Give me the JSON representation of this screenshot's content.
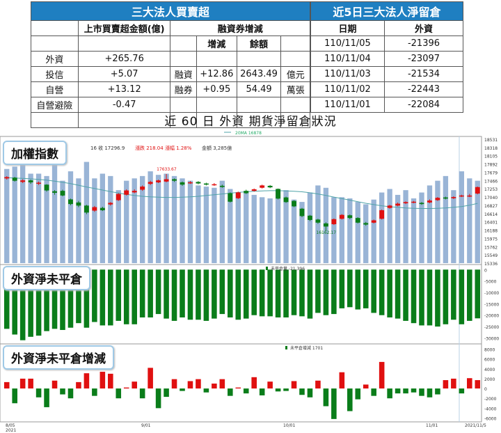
{
  "table_left": {
    "title": "三大法人買賣超",
    "col_amount": "上市買賣超金額(億)",
    "col_margin": "融資券增減",
    "col_change": "增減",
    "col_balance": "餘額",
    "rows": [
      {
        "name": "外資",
        "amount": "+265.76",
        "m_label": "",
        "m_change": "",
        "m_balance": "",
        "m_unit": ""
      },
      {
        "name": "投信",
        "amount": "+5.07",
        "m_label": "融資",
        "m_change": "+12.86",
        "m_balance": "2643.49",
        "m_unit": "億元"
      },
      {
        "name": "自營",
        "amount": "+13.12",
        "m_label": "融券",
        "m_change": "+0.95",
        "m_balance": "54.49",
        "m_unit": "萬張"
      },
      {
        "name": "自營避險",
        "amount": "-0.47",
        "m_label": "",
        "m_change": "",
        "m_balance": "",
        "m_unit": ""
      },
      {
        "name": "",
        "amount": "",
        "m_label": "",
        "m_change": "",
        "m_balance": "",
        "m_unit": ""
      }
    ]
  },
  "table_right": {
    "title": "近5日三大法人淨留倉",
    "col_date": "日期",
    "col_foreign": "外資",
    "rows": [
      {
        "date": "110/11/05",
        "value": "-21396"
      },
      {
        "date": "110/11/04",
        "value": "-23097"
      },
      {
        "date": "110/11/03",
        "value": "-21534"
      },
      {
        "date": "110/11/02",
        "value": "-22443"
      },
      {
        "date": "110/11/01",
        "value": "-22084"
      }
    ]
  },
  "heading": "近 60 日 外資 期貨淨留倉狀況",
  "chart_data": {
    "type": "bar",
    "x_labels": [
      "8/05\n2021",
      "9/01",
      "10/01",
      "11/01",
      "2021/11/5"
    ],
    "panels": [
      {
        "title": "加權指數",
        "info": "16 收 17296.9",
        "info_change": "漲跌 218.04 漲幅 1.28%",
        "info_amount": "金額 3,285億",
        "ma_legend": "20MA 16878",
        "high_label": "17633.67",
        "low_label": "16162.17",
        "yticks": [
          "18531",
          "18318",
          "18105",
          "17892",
          "17679",
          "17466",
          "17253",
          "17040",
          "16827",
          "16614",
          "16401",
          "16188",
          "15975",
          "15762",
          "15549",
          "15336"
        ],
        "ylim": [
          15336,
          18531
        ],
        "volume": [
          80,
          82,
          84,
          76,
          76,
          74,
          84,
          70,
          78,
          72,
          86,
          72,
          76,
          74,
          62,
          70,
          72,
          74,
          78,
          75,
          76,
          74,
          72,
          70,
          66,
          65,
          64,
          70,
          63,
          60,
          60,
          58,
          56,
          55,
          62,
          62,
          54,
          52,
          60,
          66,
          64,
          56,
          56,
          55,
          52,
          50,
          54,
          60,
          63,
          58,
          62,
          55,
          60,
          66,
          70,
          74,
          62,
          78,
          72,
          70
        ],
        "candles": [
          {
            "o": 17520,
            "c": 17555,
            "h": 17580,
            "l": 17490
          },
          {
            "o": 17540,
            "c": 17460,
            "h": 17560,
            "l": 17440
          },
          {
            "o": 17430,
            "c": 17470,
            "h": 17500,
            "l": 17400
          },
          {
            "o": 17470,
            "c": 17420,
            "h": 17490,
            "l": 17380
          },
          {
            "o": 17400,
            "c": 17410,
            "h": 17440,
            "l": 17350
          },
          {
            "o": 17360,
            "c": 17210,
            "h": 17370,
            "l": 17180
          },
          {
            "o": 17190,
            "c": 17150,
            "h": 17220,
            "l": 17100
          },
          {
            "o": 17200,
            "c": 17080,
            "h": 17230,
            "l": 17060
          },
          {
            "o": 16980,
            "c": 16860,
            "h": 17000,
            "l": 16830
          },
          {
            "o": 16900,
            "c": 16820,
            "h": 16940,
            "l": 16780
          },
          {
            "o": 16820,
            "c": 16640,
            "h": 16840,
            "l": 16600
          },
          {
            "o": 16690,
            "c": 16780,
            "h": 16810,
            "l": 16660
          },
          {
            "o": 16760,
            "c": 16700,
            "h": 16790,
            "l": 16680
          },
          {
            "o": 16850,
            "c": 16890,
            "h": 16910,
            "l": 16820
          },
          {
            "o": 16960,
            "c": 17120,
            "h": 17140,
            "l": 16940
          },
          {
            "o": 17100,
            "c": 17210,
            "h": 17240,
            "l": 17080
          },
          {
            "o": 17160,
            "c": 17200,
            "h": 17240,
            "l": 17140
          },
          {
            "o": 17230,
            "c": 17310,
            "h": 17340,
            "l": 17200
          },
          {
            "o": 17380,
            "c": 17430,
            "h": 17460,
            "l": 17350
          },
          {
            "o": 17420,
            "c": 17470,
            "h": 17490,
            "l": 17400
          },
          {
            "o": 17440,
            "c": 17500,
            "h": 17634,
            "l": 17420
          },
          {
            "o": 17500,
            "c": 17460,
            "h": 17520,
            "l": 17430
          },
          {
            "o": 17420,
            "c": 17360,
            "h": 17440,
            "l": 17330
          },
          {
            "o": 17400,
            "c": 17420,
            "h": 17450,
            "l": 17380
          },
          {
            "o": 17430,
            "c": 17390,
            "h": 17450,
            "l": 17370
          },
          {
            "o": 17390,
            "c": 17360,
            "h": 17410,
            "l": 17340
          },
          {
            "o": 17350,
            "c": 17370,
            "h": 17400,
            "l": 17330
          },
          {
            "o": 17330,
            "c": 17300,
            "h": 17360,
            "l": 17280
          },
          {
            "o": 17140,
            "c": 16920,
            "h": 17160,
            "l": 16900
          },
          {
            "o": 17010,
            "c": 17160,
            "h": 17180,
            "l": 16990
          },
          {
            "o": 17200,
            "c": 17140,
            "h": 17230,
            "l": 17120
          },
          {
            "o": 17200,
            "c": 17240,
            "h": 17260,
            "l": 17180
          },
          {
            "o": 17280,
            "c": 17340,
            "h": 17360,
            "l": 17260
          },
          {
            "o": 17330,
            "c": 17290,
            "h": 17350,
            "l": 17270
          },
          {
            "o": 17250,
            "c": 17000,
            "h": 17260,
            "l": 16980
          },
          {
            "o": 17030,
            "c": 16910,
            "h": 17050,
            "l": 16890
          },
          {
            "o": 16940,
            "c": 16800,
            "h": 16960,
            "l": 16780
          },
          {
            "o": 16740,
            "c": 16550,
            "h": 16760,
            "l": 16520
          },
          {
            "o": 16560,
            "c": 16450,
            "h": 16580,
            "l": 16420
          },
          {
            "o": 16460,
            "c": 16380,
            "h": 16480,
            "l": 16350
          },
          {
            "o": 16360,
            "c": 16280,
            "h": 16390,
            "l": 16162
          },
          {
            "o": 16340,
            "c": 16470,
            "h": 16490,
            "l": 16320
          },
          {
            "o": 16480,
            "c": 16580,
            "h": 16600,
            "l": 16460
          },
          {
            "o": 16570,
            "c": 16500,
            "h": 16590,
            "l": 16470
          },
          {
            "o": 16500,
            "c": 16380,
            "h": 16520,
            "l": 16360
          },
          {
            "o": 16370,
            "c": 16330,
            "h": 16400,
            "l": 16300
          },
          {
            "o": 16380,
            "c": 16440,
            "h": 16460,
            "l": 16360
          },
          {
            "o": 16480,
            "c": 16700,
            "h": 16720,
            "l": 16460
          },
          {
            "o": 16760,
            "c": 16820,
            "h": 16840,
            "l": 16740
          },
          {
            "o": 16820,
            "c": 16870,
            "h": 16900,
            "l": 16800
          },
          {
            "o": 16880,
            "c": 16910,
            "h": 16930,
            "l": 16860
          },
          {
            "o": 16900,
            "c": 16920,
            "h": 16940,
            "l": 16880
          },
          {
            "o": 16890,
            "c": 16860,
            "h": 16910,
            "l": 16840
          },
          {
            "o": 16900,
            "c": 16950,
            "h": 16980,
            "l": 16880
          },
          {
            "o": 16960,
            "c": 17020,
            "h": 17040,
            "l": 16940
          },
          {
            "o": 17030,
            "c": 17000,
            "h": 17050,
            "l": 16980
          },
          {
            "o": 17010,
            "c": 17040,
            "h": 17060,
            "l": 16990
          },
          {
            "o": 17060,
            "c": 17080,
            "h": 17100,
            "l": 17040
          },
          {
            "o": 17060,
            "c": 17079,
            "h": 17120,
            "l": 17040
          },
          {
            "o": 17130,
            "c": 17297,
            "h": 17310,
            "l": 17110
          }
        ],
        "ma": [
          17540,
          17530,
          17520,
          17510,
          17495,
          17475,
          17450,
          17420,
          17385,
          17345,
          17300,
          17260,
          17220,
          17180,
          17145,
          17110,
          17080,
          17060,
          17045,
          17035,
          17030,
          17030,
          17035,
          17045,
          17060,
          17080,
          17100,
          17120,
          17140,
          17160,
          17175,
          17190,
          17200,
          17205,
          17205,
          17200,
          17190,
          17175,
          17150,
          17120,
          17080,
          17040,
          17000,
          16960,
          16920,
          16880,
          16845,
          16815,
          16790,
          16775,
          16760,
          16750,
          16745,
          16745,
          16750,
          16760,
          16775,
          16795,
          16830,
          16878
        ]
      },
      {
        "title": "外資淨未平倉",
        "legend": "未平倉量 -21,396",
        "yticks": [
          "0",
          "-5000",
          "-10000",
          "-15000",
          "-20000",
          "-25000",
          "-30000"
        ],
        "ylim": [
          -32000,
          1000
        ],
        "values": [
          -26000,
          -28500,
          -31000,
          -29500,
          -29000,
          -27000,
          -26000,
          -26500,
          -25500,
          -23500,
          -25500,
          -23000,
          -24500,
          -24500,
          -22500,
          -24000,
          -24000,
          -21000,
          -21000,
          -19500,
          -21500,
          -22500,
          -21000,
          -22000,
          -22000,
          -22500,
          -21500,
          -19500,
          -21000,
          -22000,
          -21500,
          -20000,
          -20500,
          -20500,
          -21000,
          -21000,
          -20000,
          -20500,
          -21500,
          -19000,
          -20000,
          -19500,
          -17000,
          -16500,
          -17500,
          -17000,
          -19000,
          -20000,
          -21000,
          -21500,
          -22500,
          -23500,
          -24500,
          -24500,
          -25000,
          -24000,
          -22000,
          -24000,
          -22500,
          -21396
        ]
      },
      {
        "title": "外資淨未平倉增減",
        "legend": "未平倉增減 1701",
        "yticks": [
          "8000",
          "6000",
          "4000",
          "2000",
          "0",
          "-2000",
          "-4000",
          "-6000"
        ],
        "ylim": [
          -6500,
          8500
        ],
        "values": [
          1300,
          -3000,
          2000,
          2000,
          -1800,
          -3800,
          1600,
          -1200,
          -2000,
          1300,
          3100,
          -1500,
          3400,
          3000,
          -2000,
          200,
          1400,
          -2000,
          4200,
          -4000,
          -1700,
          1900,
          -500,
          1500,
          1900,
          -800,
          1000,
          1900,
          -1500,
          200,
          -1000,
          2300,
          -1400,
          1400,
          -600,
          -500,
          1500,
          -1300,
          -1800,
          1600,
          -3600,
          -6200,
          3300,
          -4600,
          -2200,
          800,
          -1500,
          5400,
          -2000,
          -1000,
          -1000,
          -800,
          -1500,
          -1800,
          -1200,
          1700,
          2000,
          -1000,
          2100,
          1701
        ]
      }
    ]
  },
  "colors": {
    "up": "#e01010",
    "down": "#0a7d1a",
    "volume": "#99b4d6",
    "ma": "#4fa3a8",
    "header": "#1f7fc1"
  }
}
